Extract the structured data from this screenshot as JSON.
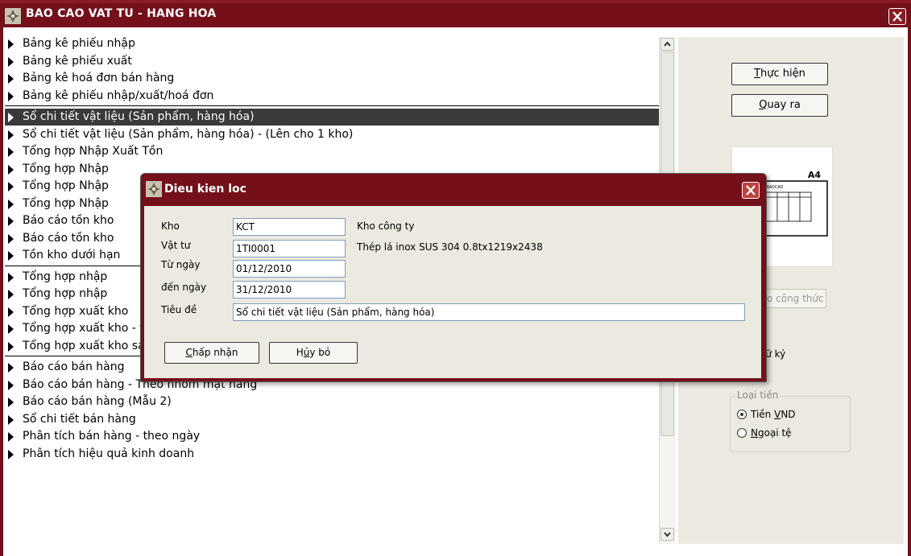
{
  "window": {
    "title": "BAO CAO VAT TU - HANG HOA",
    "icon": "app-logo-icon",
    "close_icon": "close-icon"
  },
  "report_list": {
    "groups": [
      {
        "items": [
          {
            "label": "Bảng kê phiếu nhập",
            "selected": false
          },
          {
            "label": "Bảng kê phiếu xuất",
            "selected": false
          },
          {
            "label": "Bảng kê hoá đơn bán hàng",
            "selected": false
          },
          {
            "label": "Bảng kê phiếu nhập/xuất/hoá đơn",
            "selected": false
          }
        ]
      },
      {
        "items": [
          {
            "label": "Sổ chi tiết vật liệu (Sản phẩm, hàng hóa)",
            "selected": true
          },
          {
            "label": "Sổ chi tiết vật liệu (Sản phẩm, hàng hóa) - (Lên cho 1 kho)",
            "selected": false
          },
          {
            "label": "Tổng hợp Nhập Xuất Tồn",
            "selected": false
          },
          {
            "label": "Tổng hợp Nhập",
            "selected": false
          },
          {
            "label": "Tổng hợp Nhập",
            "selected": false
          },
          {
            "label": "Tổng hợp Nhập",
            "selected": false
          },
          {
            "label": "Báo cáo tồn kho",
            "selected": false
          },
          {
            "label": "Báo cáo tồn kho",
            "selected": false
          },
          {
            "label": "Tồn kho dưới hạn",
            "selected": false
          }
        ]
      },
      {
        "items": [
          {
            "label": "Tổng hợp nhập",
            "selected": false
          },
          {
            "label": "Tổng hợp nhập",
            "selected": false
          },
          {
            "label": "Tổng hợp xuất kho",
            "selected": false
          },
          {
            "label": "Tổng hợp xuất kho - theo tài khoản đối ứng",
            "selected": false
          },
          {
            "label": "Tổng hợp xuất kho sản xuất",
            "selected": false
          }
        ]
      },
      {
        "items": [
          {
            "label": "Báo cáo bán hàng",
            "selected": false
          },
          {
            "label": "Báo cáo bán hàng - Theo nhóm mặt hàng",
            "selected": false
          },
          {
            "label": "Báo cáo bán hàng (Mẫu 2)",
            "selected": false
          },
          {
            "label": "Sổ chi tiết bán hàng",
            "selected": false
          },
          {
            "label": "Phân tích bán hàng - theo ngày",
            "selected": false
          },
          {
            "label": "Phân tích hiệu quả kinh doanh",
            "selected": false
          }
        ]
      }
    ]
  },
  "side_panel": {
    "execute_button": {
      "hotkey": "T",
      "rest": "hực hiện"
    },
    "exit_button": {
      "hotkey": "Q",
      "rest": "uay ra"
    },
    "preview": {
      "paper_size": "A4",
      "mini_title": "BAOCAO",
      "mini_code": "121"
    },
    "formula_button": "báo công thức",
    "sign_label": {
      "hotkey": "c",
      "rest": "hữ ký"
    },
    "currency": {
      "title": "Loại tiền",
      "options": [
        {
          "before": "Tiền ",
          "hotkey": "V",
          "after": "ND",
          "checked": true
        },
        {
          "before": "",
          "hotkey": "N",
          "after": "goại tệ",
          "checked": false
        }
      ]
    }
  },
  "dialog": {
    "title": "Dieu kien loc",
    "fields": {
      "kho": {
        "label": "Kho",
        "value": "KCT",
        "desc": "Kho công ty"
      },
      "vat_tu": {
        "label": "Vật tư",
        "value": "1TI0001",
        "desc": "Thép lá inox  SUS 304 0.8tx1219x2438"
      },
      "tu_ngay": {
        "label": "Từ ngày",
        "value": "01/12/2010"
      },
      "den_ngay": {
        "label": "đến ngày",
        "value": "31/12/2010"
      },
      "tieu_de": {
        "label": "Tiêu đề",
        "value": "Sổ chi tiết vật liệu (Sản phẩm, hàng hóa)"
      }
    },
    "accept_button": {
      "hotkey": "C",
      "rest": "hấp nhận"
    },
    "cancel_button": {
      "before": "H",
      "hotkey": "ủ",
      "rest": "y bỏ"
    }
  },
  "colors": {
    "title_bar": "#74101a",
    "selected_row": "#3a3a3a",
    "panel_bg": "#ece9e0"
  }
}
